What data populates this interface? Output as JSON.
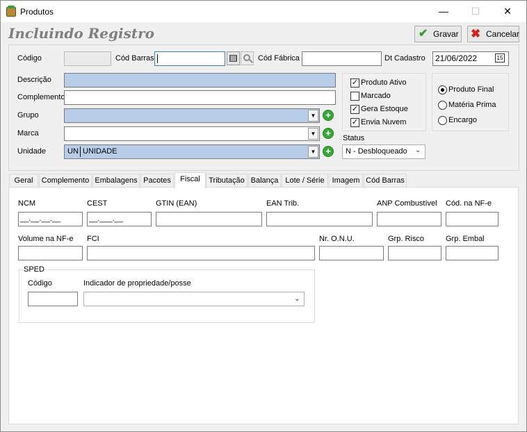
{
  "window": {
    "title": "Produtos",
    "minimize": "—",
    "maximize": "☐",
    "close": "✕"
  },
  "header": {
    "title": "Incluindo Registro",
    "save_label": "Gravar",
    "cancel_label": "Cancelar"
  },
  "form": {
    "codigo_label": "Código",
    "codigo_value": "",
    "codbarras_label": "Cód Barras",
    "codbarras_value": "",
    "codfabrica_label": "Cód Fábrica",
    "codfabrica_value": "",
    "dtcadastro_label": "Dt Cadastro",
    "dtcadastro_value": "21/06/2022",
    "descricao_label": "Descrição",
    "descricao_value": "",
    "complemento_label": "Complemento",
    "complemento_value": "",
    "grupo_label": "Grupo",
    "grupo_value": "",
    "marca_label": "Marca",
    "marca_value": "",
    "unidade_label": "Unidade",
    "unidade_code": "UN",
    "unidade_value": "UNIDADE"
  },
  "checks": {
    "ativo": "Produto Ativo",
    "marcado": "Marcado",
    "estoque": "Gera Estoque",
    "nuvem": "Envia Nuvem",
    "ativo_checked": true,
    "marcado_checked": false,
    "estoque_checked": true,
    "nuvem_checked": true
  },
  "radios": {
    "final": "Produto Final",
    "materia": "Matéria Prima",
    "encargo": "Encargo",
    "selected": "Produto Final"
  },
  "status": {
    "label": "Status",
    "value": "N - Desbloqueado"
  },
  "tabs": [
    "Geral",
    "Complemento",
    "Embalagens",
    "Pacotes",
    "Fiscal",
    "Tributação",
    "Balança",
    "Lote / Série",
    "Imagem",
    "Cód Barras"
  ],
  "active_tab": "Fiscal",
  "fiscal": {
    "ncm_label": "NCM",
    "ncm_mask": "__.__.__.__",
    "cest_label": "CEST",
    "cest_mask": "__.___.__",
    "gtin_label": "GTIN (EAN)",
    "eantrib_label": "EAN Trib.",
    "anp_label": "ANP Combustível",
    "codnfe_label": "Cód. na NF-e",
    "volume_label": "Volume na NF-e",
    "fci_label": "FCI",
    "onu_label": "Nr. O.N.U.",
    "risco_label": "Grp. Risco",
    "embal_label": "Grp. Embal",
    "sped_legend": "SPED",
    "sped_codigo_label": "Código",
    "sped_indicador_label": "Indicador de propriedade/posse"
  }
}
